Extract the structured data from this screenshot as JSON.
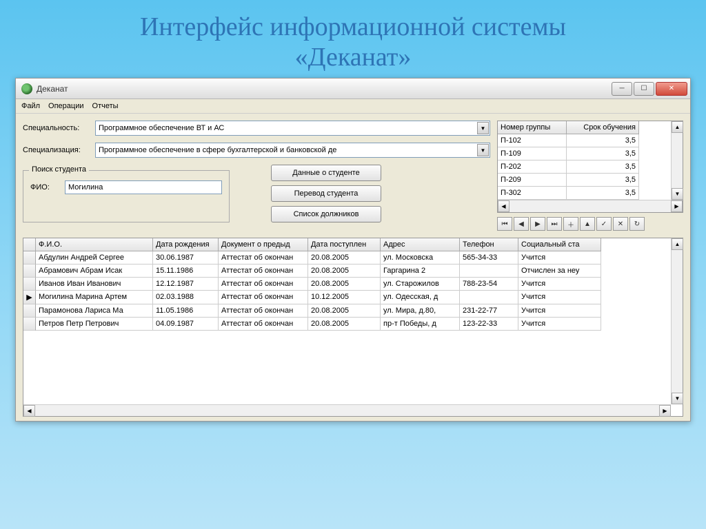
{
  "slide_title_line1": "Интерфейс информационной системы",
  "slide_title_line2": "«Деканат»",
  "titlebar": {
    "text": "Деканат"
  },
  "menu": {
    "file": "Файл",
    "operations": "Операции",
    "reports": "Отчеты"
  },
  "labels": {
    "speciality": "Специальность:",
    "specialization": "Специализация:",
    "search_legend": "Поиск студента",
    "fio_label": "ФИО:"
  },
  "combos": {
    "speciality": "Программное обеспечение ВТ и АС",
    "specialization": "Программное обеспечение в сфере бухгалтерской и банковской де"
  },
  "buttons": {
    "student_data": "Данные о студенте",
    "transfer": "Перевод студента",
    "debtors": "Список должников"
  },
  "search": {
    "fio_value": "Могилина"
  },
  "groups": {
    "headers": {
      "num": "Номер группы",
      "term": "Срок обучения"
    },
    "rows": [
      {
        "num": "П-102",
        "term": "3,5"
      },
      {
        "num": "П-109",
        "term": "3,5"
      },
      {
        "num": "П-202",
        "term": "3,5"
      },
      {
        "num": "П-209",
        "term": "3,5"
      },
      {
        "num": "П-302",
        "term": "3,5"
      }
    ]
  },
  "students": {
    "headers": {
      "fio": "Ф.И.О.",
      "dob": "Дата рождения",
      "doc": "Документ о предыд",
      "adm": "Дата поступлен",
      "addr": "Адрес",
      "tel": "Телефон",
      "stat": "Социальный ста"
    },
    "rows": [
      {
        "mark": "",
        "fio": "Абдулин Андрей Сергее",
        "dob": "30.06.1987",
        "doc": "Аттестат об окончан",
        "adm": "20.08.2005",
        "addr": "ул. Московска",
        "tel": "565-34-33",
        "stat": "Учится"
      },
      {
        "mark": "",
        "fio": "Абрамович Абрам Исак",
        "dob": "15.11.1986",
        "doc": "Аттестат об окончан",
        "adm": "20.08.2005",
        "addr": "Гаргарина 2",
        "tel": "",
        "stat": "Отчислен за неу"
      },
      {
        "mark": "",
        "fio": "Иванов Иван Иванович",
        "dob": "12.12.1987",
        "doc": "Аттестат об окончан",
        "adm": "20.08.2005",
        "addr": "ул. Старожилов",
        "tel": "788-23-54",
        "stat": "Учится"
      },
      {
        "mark": "▶",
        "fio": "Могилина Марина Артем",
        "dob": "02.03.1988",
        "doc": "Аттестат об окончан",
        "adm": "10.12.2005",
        "addr": "ул. Одесская, д",
        "tel": "",
        "stat": "Учится"
      },
      {
        "mark": "",
        "fio": "Парамонова Лариса Ма",
        "dob": "11.05.1986",
        "doc": "Аттестат об окончан",
        "adm": "20.08.2005",
        "addr": "ул. Мира, д.80,",
        "tel": "231-22-77",
        "stat": "Учится"
      },
      {
        "mark": "",
        "fio": "Петров Петр Петрович",
        "dob": "04.09.1987",
        "doc": "Аттестат об окончан",
        "adm": "20.08.2005",
        "addr": "пр-т Победы, д",
        "tel": "123-22-33",
        "stat": "Учится"
      }
    ]
  },
  "nav_icons": [
    "⏮",
    "◀",
    "▶",
    "⏭",
    "＋",
    "▲",
    "✓",
    "✕",
    "↻"
  ]
}
